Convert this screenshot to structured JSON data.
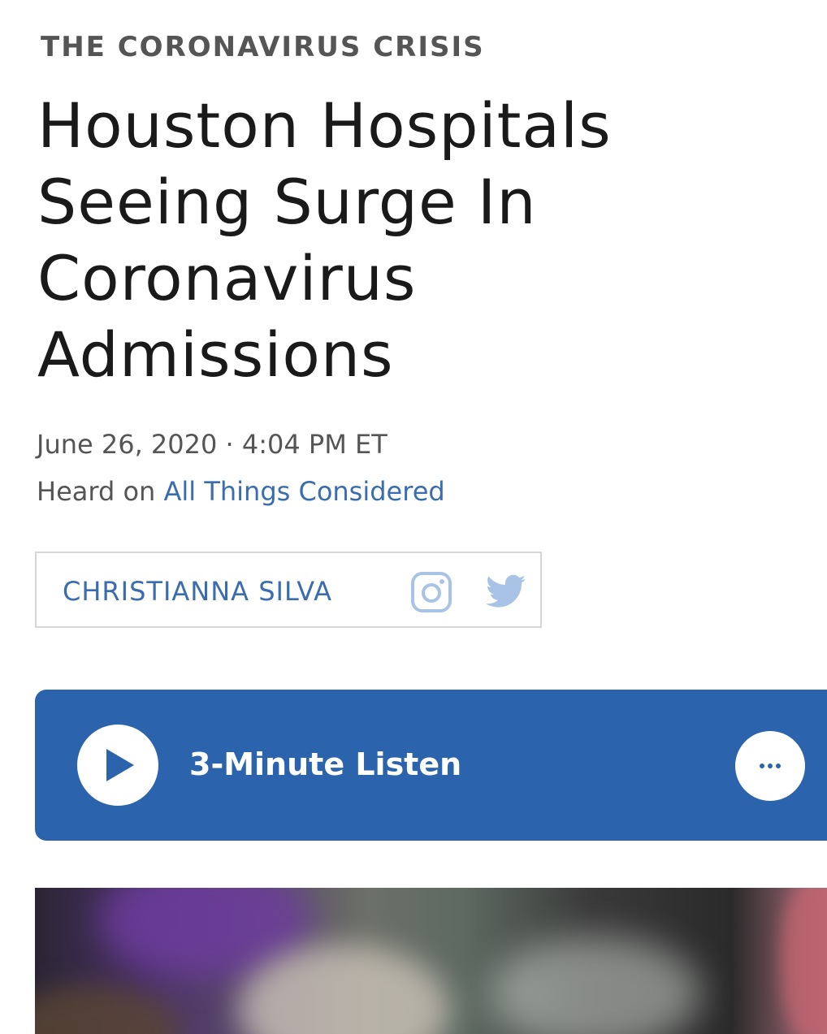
{
  "article": {
    "section_slug": "THE CORONAVIRUS CRISIS",
    "headline": "Houston Hospitals Seeing Surge In Coronavirus Admissions",
    "dateline": "June 26, 2020 · 4:04 PM ET",
    "heard_on_prefix": "Heard on ",
    "heard_on_program": "All Things Considered"
  },
  "byline": {
    "author": "CHRISTIANNA SILVA",
    "icons": [
      "instagram-icon",
      "twitter-icon"
    ]
  },
  "audio_player": {
    "label": "3-Minute Listen",
    "play_icon": "play-icon",
    "more_icon": "more-options-icon"
  },
  "colors": {
    "link_blue": "#3a6cb0",
    "player_blue": "#2b64ad",
    "text_dark": "#1a1a1a",
    "text_gray": "#555555"
  }
}
